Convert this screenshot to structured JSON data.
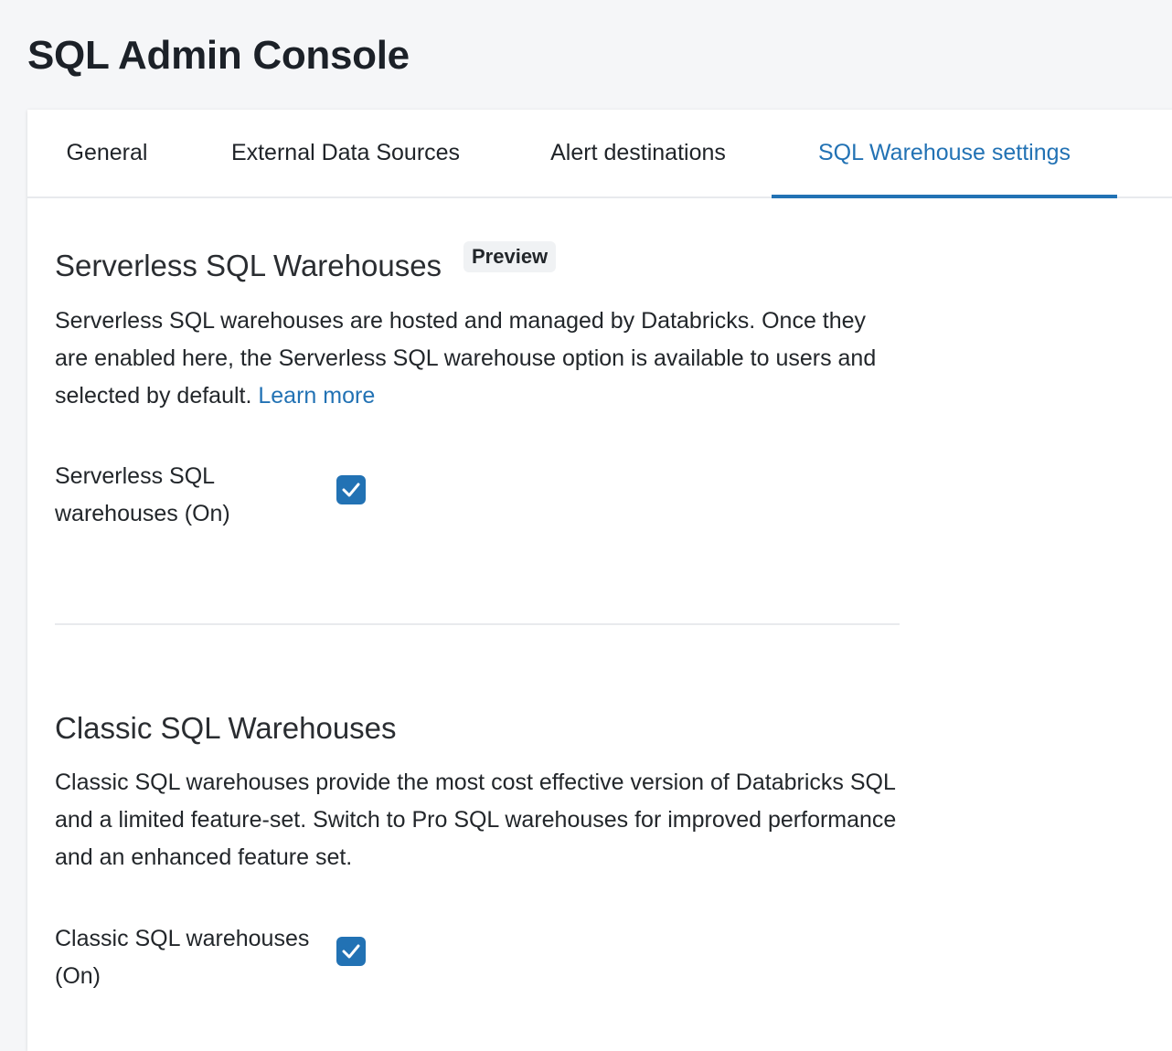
{
  "page": {
    "title": "SQL Admin Console"
  },
  "tabs": [
    {
      "label": "General",
      "active": false
    },
    {
      "label": "External Data Sources",
      "active": false
    },
    {
      "label": "Alert destinations",
      "active": false
    },
    {
      "label": "SQL Warehouse settings",
      "active": true
    }
  ],
  "serverless": {
    "title": "Serverless SQL Warehouses",
    "badge": "Preview",
    "description": "Serverless SQL warehouses are hosted and managed by Databricks. Once they are enabled here, the Serverless SQL warehouse option is available to users and selected by default.",
    "link_text": "Learn more",
    "setting_label": "Serverless SQL warehouses (On)",
    "checked": true
  },
  "classic": {
    "title": "Classic SQL Warehouses",
    "description": "Classic SQL warehouses provide the most cost effective version of Databricks SQL and a limited feature-set. Switch to Pro SQL warehouses for improved performance and an enhanced feature set.",
    "setting_label": "Classic SQL warehouses (On)",
    "checked": true
  },
  "colors": {
    "accent": "#2272b4",
    "text": "#22262a",
    "background": "#f5f6f8"
  }
}
